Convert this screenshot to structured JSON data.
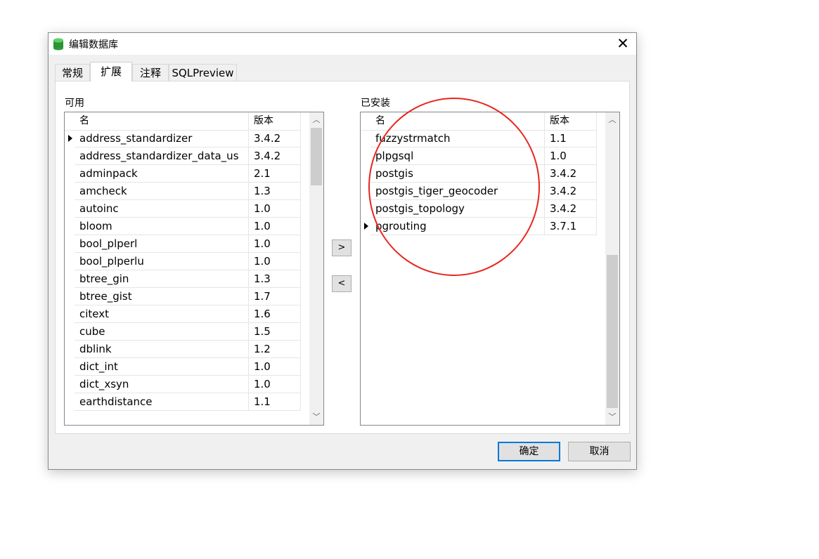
{
  "window": {
    "title": "编辑数据库",
    "close_glyph": "✕"
  },
  "tabs": [
    {
      "label": "常规",
      "active": false
    },
    {
      "label": "扩展",
      "active": true
    },
    {
      "label": "注释",
      "active": false
    },
    {
      "label": "SQLPreview",
      "active": false
    }
  ],
  "available": {
    "label": "可用",
    "columns": [
      "名",
      "版本"
    ],
    "rows": [
      {
        "name": "address_standardizer",
        "version": "3.4.2",
        "current": true
      },
      {
        "name": "address_standardizer_data_us",
        "version": "3.4.2"
      },
      {
        "name": "adminpack",
        "version": "2.1"
      },
      {
        "name": "amcheck",
        "version": "1.3"
      },
      {
        "name": "autoinc",
        "version": "1.0"
      },
      {
        "name": "bloom",
        "version": "1.0"
      },
      {
        "name": "bool_plperl",
        "version": "1.0"
      },
      {
        "name": "bool_plperlu",
        "version": "1.0"
      },
      {
        "name": "btree_gin",
        "version": "1.3"
      },
      {
        "name": "btree_gist",
        "version": "1.7"
      },
      {
        "name": "citext",
        "version": "1.6"
      },
      {
        "name": "cube",
        "version": "1.5"
      },
      {
        "name": "dblink",
        "version": "1.2"
      },
      {
        "name": "dict_int",
        "version": "1.0"
      },
      {
        "name": "dict_xsyn",
        "version": "1.0"
      },
      {
        "name": "earthdistance",
        "version": "1.1"
      }
    ]
  },
  "installed": {
    "label": "已安装",
    "columns": [
      "名",
      "版本"
    ],
    "rows": [
      {
        "name": "fuzzystrmatch",
        "version": "1.1"
      },
      {
        "name": "plpgsql",
        "version": "1.0"
      },
      {
        "name": "postgis",
        "version": "3.4.2"
      },
      {
        "name": "postgis_tiger_geocoder",
        "version": "3.4.2"
      },
      {
        "name": "postgis_topology",
        "version": "3.4.2"
      },
      {
        "name": "pgrouting",
        "version": "3.7.1",
        "current": true
      }
    ]
  },
  "move_buttons": {
    "add": ">",
    "remove": "<"
  },
  "buttons": {
    "ok": "确定",
    "cancel": "取消"
  },
  "scroll_arrows": {
    "up": "︿",
    "down": "﹀"
  },
  "colors": {
    "annotation_circle": "#e8251f",
    "primary_button_border": "#0078d7",
    "icon_green": "#2e9b3a"
  }
}
